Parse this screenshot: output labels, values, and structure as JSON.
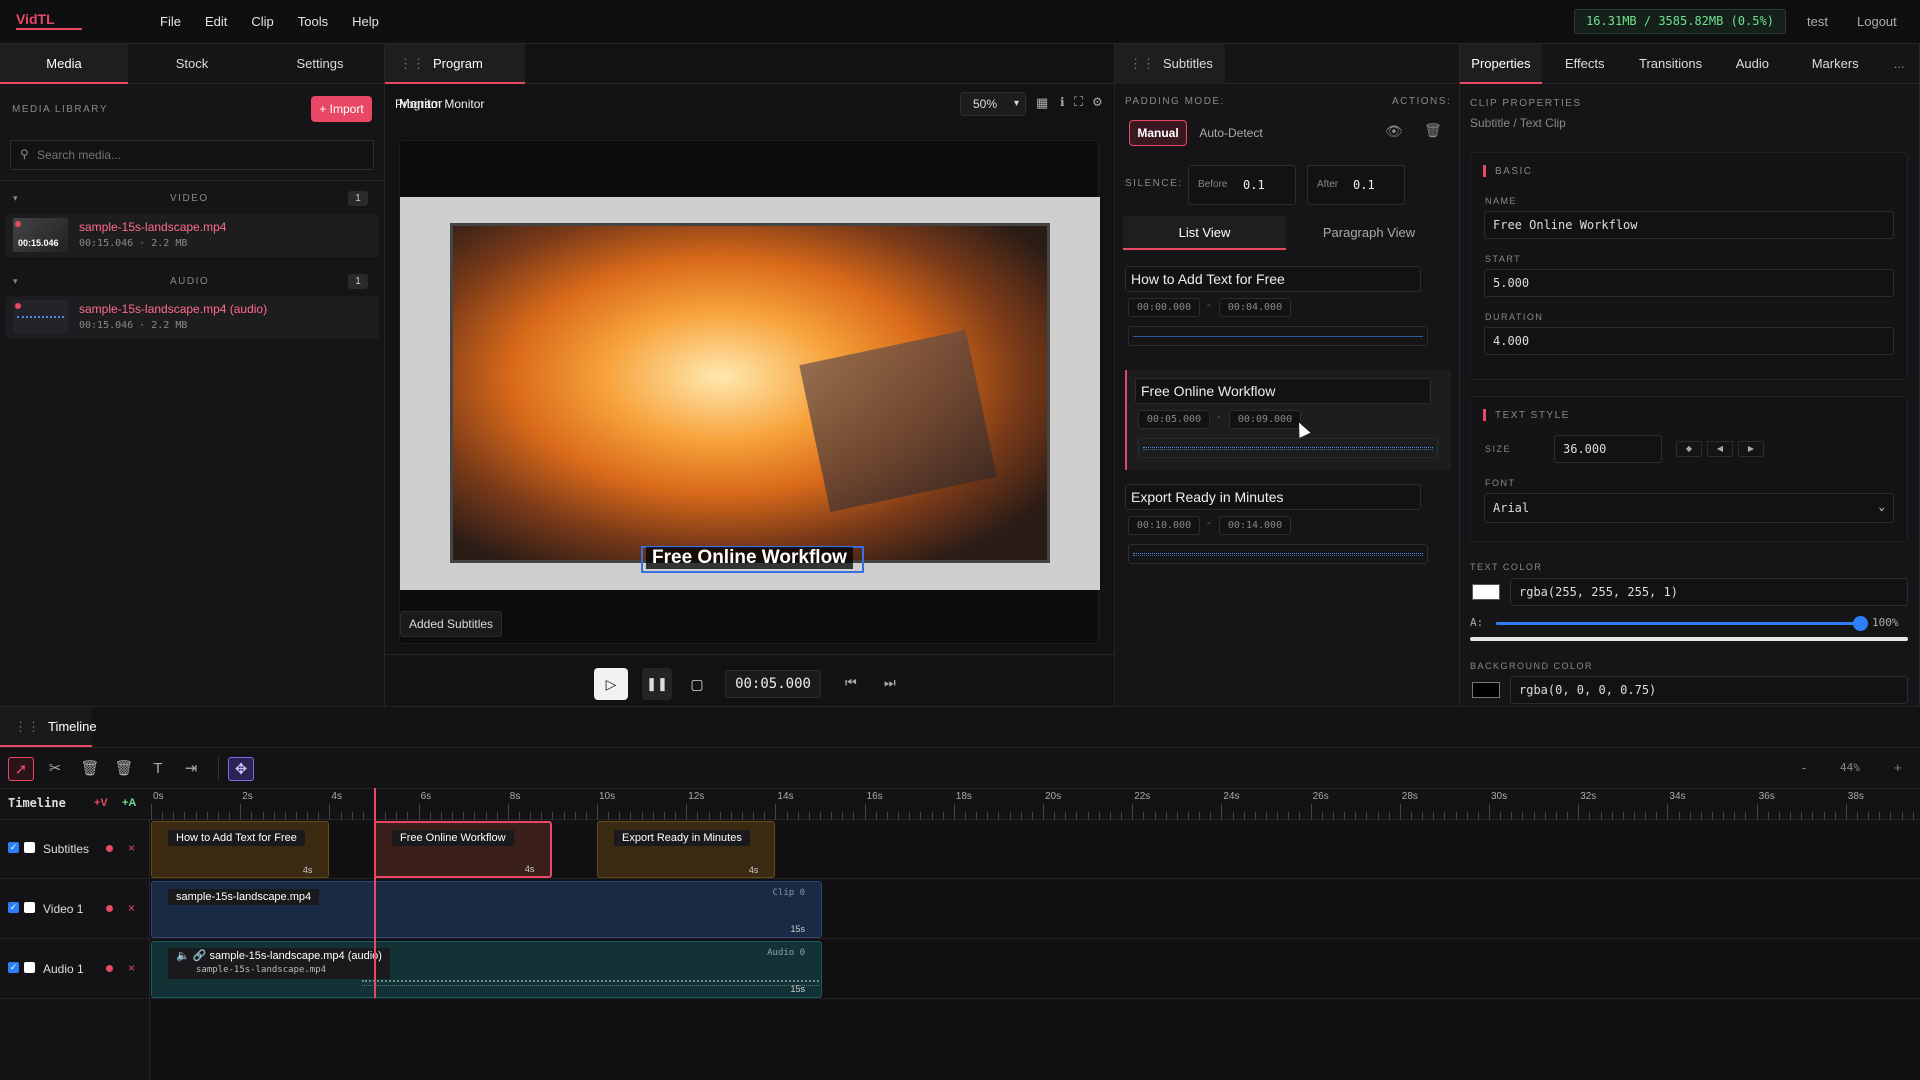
{
  "app": {
    "logo_a": "Vid",
    "logo_b": "TL",
    "menu": [
      "File",
      "Edit",
      "Clip",
      "Tools",
      "Help"
    ],
    "memory": "16.31MB / 3585.82MB (0.5%)",
    "user": "test",
    "logout": "Logout"
  },
  "left": {
    "tabs": [
      "Media",
      "Stock",
      "Settings"
    ],
    "library_label": "MEDIA LIBRARY",
    "import_label": "+ Import",
    "search_placeholder": "Search media...",
    "video_group": "VIDEO",
    "video_count": "1",
    "audio_group": "AUDIO",
    "audio_count": "1",
    "items": [
      {
        "name": "sample-15s-landscape.mp4",
        "meta": "00:15.046 · 2.2 MB",
        "thumb_time": "00:15.046"
      },
      {
        "name": "sample-15s-landscape.mp4 (audio)",
        "meta": "00:15.046 · 2.2 MB"
      }
    ]
  },
  "monitor": {
    "tab": "Program Monitor",
    "title": "Program Monitor",
    "zoom": "50%",
    "overlay_text": "Free Online Workflow",
    "status": "Added Subtitles",
    "timecode": "00:05.000"
  },
  "subtitles": {
    "tab": "Subtitles",
    "padding_label": "PADDING MODE:",
    "actions_label": "ACTIONS:",
    "manual": "Manual",
    "auto": "Auto-Detect",
    "silence_label": "SILENCE:",
    "before_label": "Before",
    "before_value": "0.1",
    "after_label": "After",
    "after_value": "0.1",
    "list_view": "List View",
    "paragraph_view": "Paragraph View",
    "items": [
      {
        "text": "How to Add Text for Free",
        "start": "00:00.000",
        "end": "00:04.000"
      },
      {
        "text": "Free Online Workflow",
        "start": "00:05.000",
        "end": "00:09.000"
      },
      {
        "text": "Export Ready in Minutes",
        "start": "00:10.000",
        "end": "00:14.000"
      }
    ],
    "dash": "-"
  },
  "properties": {
    "tabs": [
      "Properties",
      "Effects",
      "Transitions",
      "Audio",
      "Markers"
    ],
    "more": "...",
    "clip_props": "CLIP PROPERTIES",
    "clip_type": "Subtitle / Text Clip",
    "basic": "BASIC",
    "name_label": "NAME",
    "name_value": "Free Online Workflow",
    "start_label": "START",
    "start_value": "5.000",
    "duration_label": "DURATION",
    "duration_value": "4.000",
    "text_style": "TEXT STYLE",
    "size_label": "SIZE",
    "size_value": "36.000",
    "font_label": "FONT",
    "font_value": "Arial",
    "text_color_label": "TEXT COLOR",
    "text_color_value": "rgba(255, 255, 255, 1)",
    "alpha_label": "A:",
    "alpha_value": "100%",
    "alpha_level": 1.0,
    "bg_color_label": "BACKGROUND COLOR",
    "bg_color_value": "rgba(0, 0, 0, 0.75)"
  },
  "timeline": {
    "tab": "Timeline",
    "label": "Timeline",
    "add_v": "+V",
    "add_a": "+A",
    "zoom": "44%",
    "minus": "-",
    "plus": "+",
    "ruler": [
      "0s",
      "2s",
      "4s",
      "6s",
      "8s",
      "10s",
      "12s",
      "14s",
      "16s",
      "18s",
      "20s",
      "22s",
      "24s",
      "26s",
      "28s",
      "30s",
      "32s",
      "34s",
      "36s",
      "38s"
    ],
    "tracks": [
      {
        "name": "Subtitles"
      },
      {
        "name": "Video 1"
      },
      {
        "name": "Audio 1"
      }
    ],
    "subtitle_clips": [
      {
        "label": "How to Add Text for Free",
        "dur": "4s",
        "start": 0,
        "length": 4
      },
      {
        "label": "Free Online Workflow",
        "dur": "4s",
        "start": 5,
        "length": 4
      },
      {
        "label": "Export Ready in Minutes",
        "dur": "4s",
        "start": 10,
        "length": 4
      }
    ],
    "video_clip": {
      "label": "sample-15s-landscape.mp4",
      "tag": "Clip 0",
      "dur": "15s",
      "start": 0,
      "length": 15.046
    },
    "audio_clip": {
      "label": "sample-15s-landscape.mp4 (audio)",
      "sub": "sample-15s-landscape.mp4",
      "tag": "Audio 0",
      "dur": "15s",
      "start": 0,
      "length": 15.046
    },
    "playhead": 5,
    "x_icon": "×"
  },
  "colors": {
    "accent": "#e94766",
    "subtitle_clip": "#3a2a12",
    "video_clip": "#1b2a44",
    "audio_clip": "#133236"
  }
}
